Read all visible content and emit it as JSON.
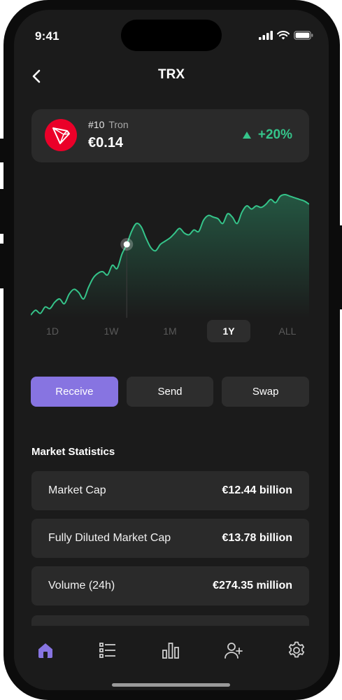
{
  "status_bar": {
    "time": "9:41"
  },
  "header": {
    "title": "TRX",
    "back_icon": "chevron-left-icon"
  },
  "coin": {
    "rank": "#10",
    "name": "Tron",
    "price": "€0.14",
    "change": "+20%",
    "change_color": "#35c48a",
    "logo_color": "#eb0029",
    "logo_icon": "tron-logo-icon"
  },
  "chart_data": {
    "type": "area",
    "color": "#35c48a",
    "values": [
      0.108,
      0.111,
      0.109,
      0.113,
      0.112,
      0.116,
      0.118,
      0.115,
      0.121,
      0.124,
      0.122,
      0.118,
      0.125,
      0.131,
      0.134,
      0.135,
      0.133,
      0.139,
      0.137,
      0.146,
      0.152,
      0.16,
      0.165,
      0.163,
      0.156,
      0.15,
      0.148,
      0.152,
      0.154,
      0.156,
      0.159,
      0.162,
      0.159,
      0.158,
      0.161,
      0.16,
      0.167,
      0.17,
      0.169,
      0.168,
      0.165,
      0.171,
      0.169,
      0.165,
      0.172,
      0.176,
      0.174,
      0.176,
      0.175,
      0.177,
      0.18,
      0.178,
      0.182,
      0.183,
      0.182,
      0.181,
      0.18,
      0.179,
      0.177
    ],
    "highlight_index": 20
  },
  "range_tabs": [
    {
      "label": "1D",
      "active": false
    },
    {
      "label": "1W",
      "active": false
    },
    {
      "label": "1M",
      "active": false
    },
    {
      "label": "1Y",
      "active": true
    },
    {
      "label": "ALL",
      "active": false
    }
  ],
  "actions": {
    "receive": "Receive",
    "send": "Send",
    "swap": "Swap",
    "accent": "#8774e1"
  },
  "market": {
    "title": "Market Statistics",
    "rows": [
      {
        "label": "Market Cap",
        "value": "€12.44 billion"
      },
      {
        "label": "Fully Diluted Market Cap",
        "value": "€13.78 billion"
      },
      {
        "label": "Volume (24h)",
        "value": "€274.35 million"
      }
    ]
  },
  "tabbar": {
    "items": [
      {
        "icon": "home-icon",
        "active": true
      },
      {
        "icon": "list-icon",
        "active": false
      },
      {
        "icon": "bar-chart-icon",
        "active": false
      },
      {
        "icon": "add-user-icon",
        "active": false
      },
      {
        "icon": "gear-icon",
        "active": false
      }
    ]
  }
}
